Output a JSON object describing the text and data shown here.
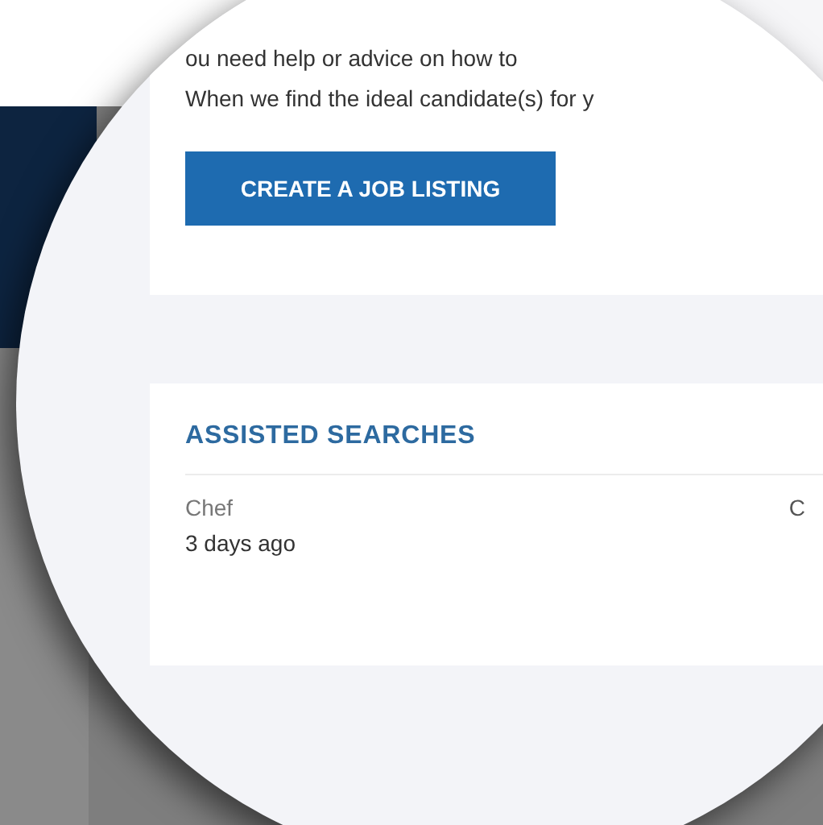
{
  "intro_card": {
    "lines": [
      "ou need help or advice on how to",
      "When we find the ideal candidate(s) for y"
    ],
    "button": "CREATE A JOB LISTING"
  },
  "assisted_searches": {
    "title": "ASSISTED SEARCHES",
    "rows": [
      {
        "title": "Chef",
        "time": "3 days ago",
        "column_2": "C"
      }
    ]
  }
}
